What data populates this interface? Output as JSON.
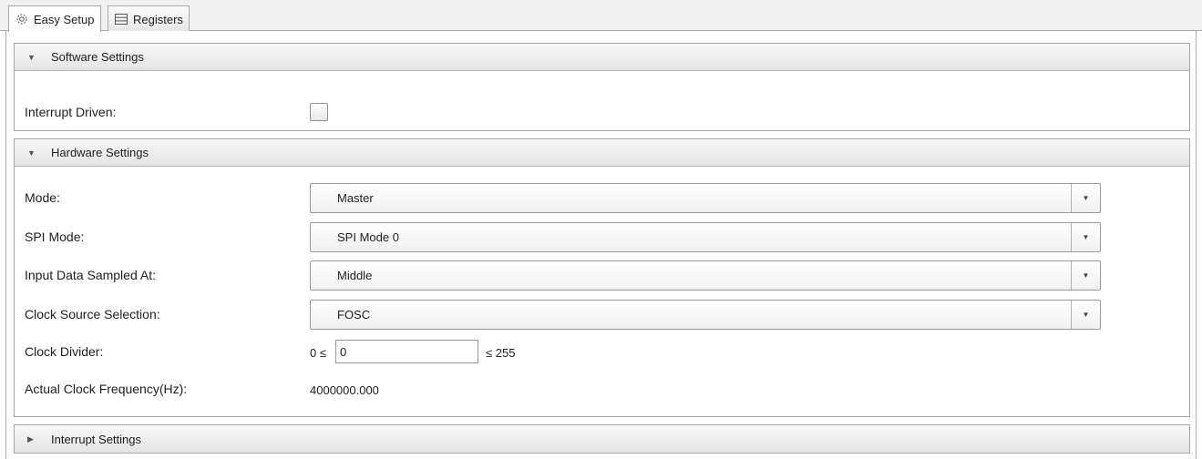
{
  "tabs": [
    {
      "label": "Easy Setup",
      "icon": "gear-icon",
      "active": true
    },
    {
      "label": "Registers",
      "icon": "table-icon",
      "active": false
    }
  ],
  "software": {
    "title": "Software Settings",
    "interrupt_driven_label": "Interrupt Driven:",
    "interrupt_driven_checked": false
  },
  "hardware": {
    "title": "Hardware Settings",
    "mode_label": "Mode:",
    "mode_value": "Master",
    "spi_mode_label": "SPI Mode:",
    "spi_mode_value": "SPI Mode 0",
    "sampled_label": "Input Data Sampled At:",
    "sampled_value": "Middle",
    "clock_source_label": "Clock Source Selection:",
    "clock_source_value": "FOSC",
    "clock_divider_label": "Clock Divider:",
    "clock_divider_min": "0 ≤",
    "clock_divider_value": "0",
    "clock_divider_max": "≤ 255",
    "actual_freq_label": "Actual Clock Frequency(Hz):",
    "actual_freq_value": "4000000.000"
  },
  "interrupt": {
    "title": "Interrupt Settings"
  }
}
